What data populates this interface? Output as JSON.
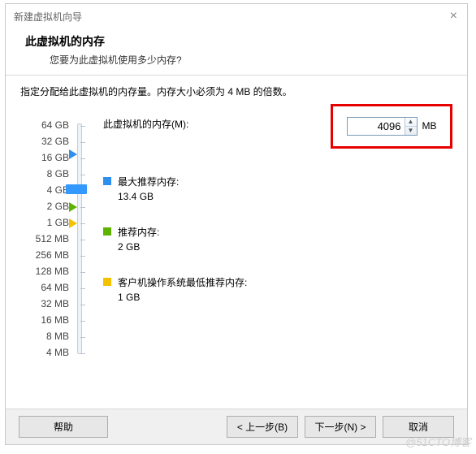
{
  "title": "新建虚拟机向导",
  "banner": {
    "heading": "此虚拟机的内存",
    "sub": "您要为此虚拟机使用多少内存?"
  },
  "instruction": "指定分配给此虚拟机的内存量。内存大小必须为 4 MB 的倍数。",
  "memory": {
    "label": "此虚拟机的内存(M):",
    "value": "4096",
    "unit": "MB"
  },
  "slider_labels": [
    "64 GB",
    "32 GB",
    "16 GB",
    "8 GB",
    "4 GB",
    "2 GB",
    "1 GB",
    "512 MB",
    "256 MB",
    "128 MB",
    "64 MB",
    "32 MB",
    "16 MB",
    "8 MB",
    "4 MB"
  ],
  "rec": {
    "max": {
      "label": "最大推荐内存:",
      "value": "13.4 GB"
    },
    "rec": {
      "label": "推荐内存:",
      "value": "2 GB"
    },
    "min": {
      "label": "客户机操作系统最低推荐内存:",
      "value": "1 GB"
    }
  },
  "buttons": {
    "help": "帮助",
    "back": "< 上一步(B)",
    "next": "下一步(N) >",
    "cancel": "取消"
  },
  "watermark": "@51CTO博客"
}
